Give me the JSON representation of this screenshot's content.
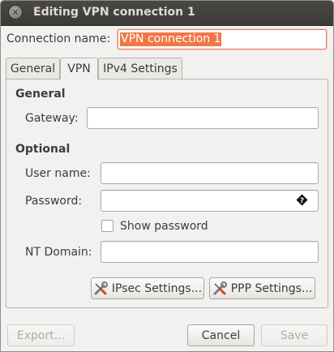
{
  "window": {
    "title": "Editing VPN connection 1"
  },
  "connection_name": {
    "label": "Connection name:",
    "value": "VPN connection 1"
  },
  "tabs": [
    {
      "label": "General",
      "active": false
    },
    {
      "label": "VPN",
      "active": true
    },
    {
      "label": "IPv4 Settings",
      "active": false
    }
  ],
  "vpn": {
    "general_section": "General",
    "gateway_label": "Gateway:",
    "gateway_value": "",
    "optional_section": "Optional",
    "username_label": "User name:",
    "username_value": "",
    "password_label": "Password:",
    "password_value": "",
    "show_password_label": "Show password",
    "show_password_checked": false,
    "nt_domain_label": "NT Domain:",
    "nt_domain_value": "",
    "ipsec_button": "IPsec Settings...",
    "ppp_button": "PPP Settings..."
  },
  "footer": {
    "export_button": "Export...",
    "cancel_button": "Cancel",
    "save_button": "Save"
  },
  "icons": {
    "close": "close-icon",
    "password_warning": "warning-diamond-icon",
    "settings_tool": "wrench-screwdriver-icon"
  },
  "colors": {
    "titlebar": "#3c3b37",
    "selection": "#f07746",
    "focus_border": "#e0835a"
  }
}
